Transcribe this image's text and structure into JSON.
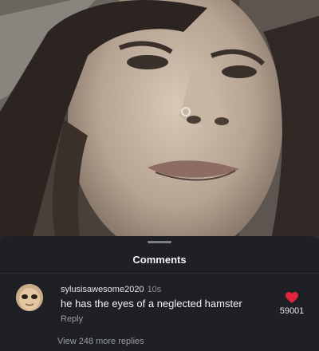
{
  "sheet": {
    "title": "Comments"
  },
  "comment": {
    "username": "sylusisawesome2020",
    "time": "10s",
    "text": "he has the eyes of a neglected hamster",
    "reply_label": "Reply",
    "likes": "59001",
    "liked": true,
    "heart_color": "#e0243a",
    "avatar_icon": "user-avatar-photo"
  },
  "view_more_replies": "View 248 more replies",
  "colors": {
    "sheet_bg": "#1f2026",
    "accent_heart": "#e0243a"
  }
}
